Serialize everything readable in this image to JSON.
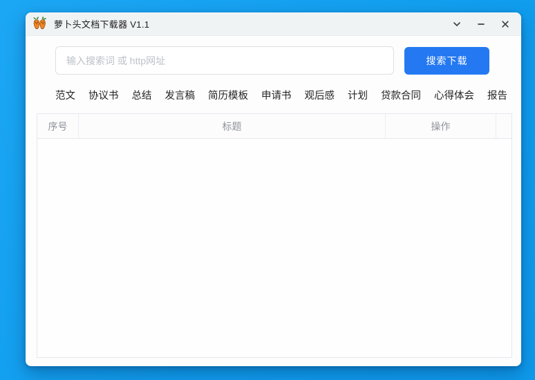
{
  "window": {
    "title": "萝卜头文档下载器 V1.1",
    "controls": {
      "collapse_icon": "chevron-down-icon",
      "minimize_icon": "minus-icon",
      "close_icon": "close-icon"
    },
    "app_icon": "carrot-icon"
  },
  "search": {
    "placeholder": "输入搜索词 或 http网址",
    "value": "",
    "button_label": "搜索下载"
  },
  "categories": [
    "范文",
    "协议书",
    "总结",
    "发言稿",
    "简历模板",
    "申请书",
    "观后感",
    "计划",
    "贷款合同",
    "心得体会",
    "报告"
  ],
  "table": {
    "columns": [
      "序号",
      "标题",
      "操作"
    ],
    "rows": []
  },
  "colors": {
    "desktop_blue": "#12A0EF",
    "primary_button_blue": "#2479F2",
    "titlebar_gray": "#F0F3F4",
    "table_header_text": "#909399",
    "table_border": "#E4E8EC",
    "placeholder_text": "#BCC1C9"
  }
}
